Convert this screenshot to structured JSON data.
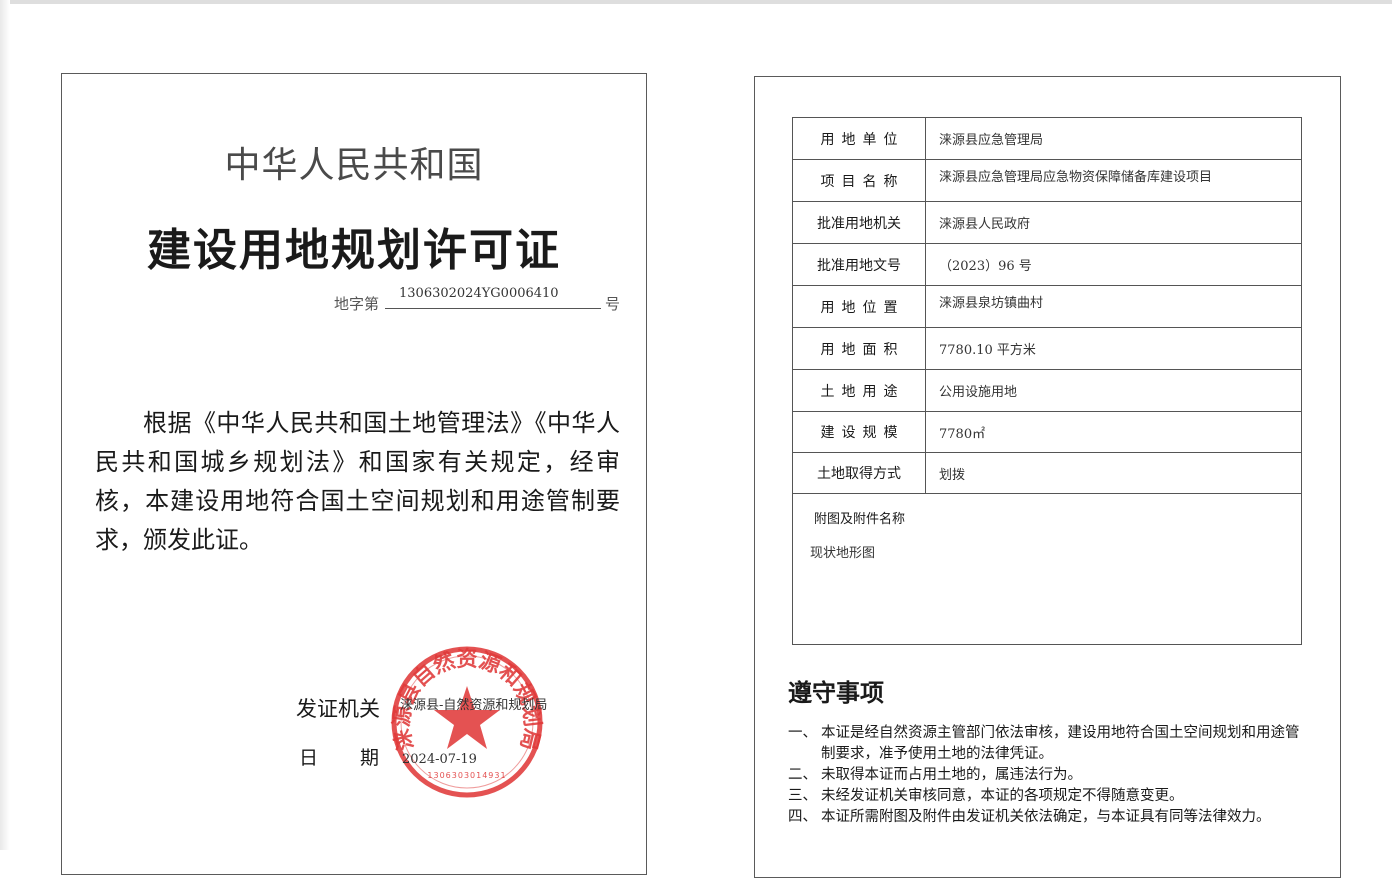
{
  "left_page": {
    "country": "中华人民共和国",
    "title": "建设用地规划许可证",
    "number_prefix": "地字第",
    "number_value": "1306302024YG0006410",
    "number_suffix": "号",
    "body_text": "根据《中华人民共和国土地管理法》《中华人民共和国城乡规划法》和国家有关规定，经审核，本建设用地符合国土空间规划和用途管制要求，颁发此证。",
    "issuer_label": "发证机关",
    "issuer_value": "涞源县-自然资源和规划局",
    "date_label_chars": [
      "日",
      "期"
    ],
    "date_value": "2024-07-19",
    "seal": {
      "ring_text": "涞源县自然资源和规划局",
      "bottom_code": "1306303014931",
      "color": "#e03a3a"
    }
  },
  "right_page": {
    "rows": [
      {
        "label": "用地单位",
        "value": "涞源县应急管理局",
        "spaced": true
      },
      {
        "label": "项目名称",
        "value": "涞源县应急管理局应急物资保障储备库建设项目",
        "spaced": true,
        "top": true
      },
      {
        "label": "批准用地机关",
        "value": "涞源县人民政府",
        "spaced": false
      },
      {
        "label": "批准用地文号",
        "value": "（2023）96 号",
        "spaced": false
      },
      {
        "label": "用地位置",
        "value": "涞源县泉坊镇曲村",
        "spaced": true,
        "top": true
      },
      {
        "label": "用地面积",
        "value": "7780.10 平方米",
        "spaced": true
      },
      {
        "label": "土地用途",
        "value": "公用设施用地",
        "spaced": true
      },
      {
        "label": "建设规模",
        "value": "7780㎡",
        "spaced": true
      },
      {
        "label": "土地取得方式",
        "value": "划拨",
        "spaced": false
      }
    ],
    "attachments_label": "附图及附件名称",
    "attachments_value": "现状地形图",
    "notice_title": "遵守事项",
    "notices": [
      {
        "num": "一、",
        "text": "本证是经自然资源主管部门依法审核，建设用地符合国土空间规划和用途管制要求，准予使用土地的法律凭证。"
      },
      {
        "num": "二、",
        "text": "未取得本证而占用土地的，属违法行为。"
      },
      {
        "num": "三、",
        "text": "未经发证机关审核同意，本证的各项规定不得随意变更。"
      },
      {
        "num": "四、",
        "text": "本证所需附图及附件由发证机关依法确定，与本证具有同等法律效力。"
      }
    ]
  }
}
